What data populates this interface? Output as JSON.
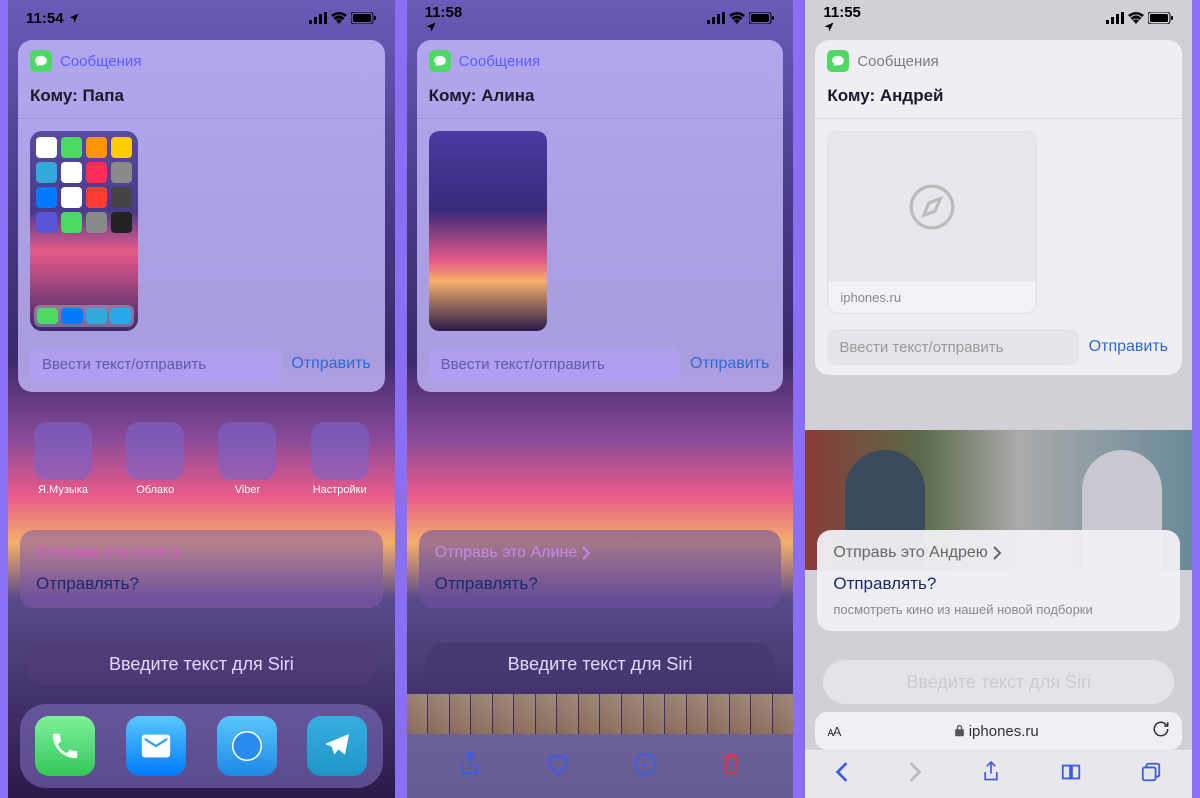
{
  "screens": [
    {
      "status_time": "11:54",
      "app_title": "Сообщения",
      "to_prefix": "Кому:",
      "to_name": "Папа",
      "input_placeholder": "Ввести текст/отправить",
      "send_label": "Отправить",
      "siri_suggestion": "Отправь это папе",
      "siri_confirm": "Отправлять?",
      "siri_input": "Введите текст для Siri",
      "home_apps": [
        "Я.Музыка",
        "Облако",
        "Viber",
        "Настройки"
      ]
    },
    {
      "status_time": "11:58",
      "app_title": "Сообщения",
      "to_prefix": "Кому:",
      "to_name": "Алина",
      "input_placeholder": "Ввести текст/отправить",
      "send_label": "Отправить",
      "siri_suggestion": "Отправь это Алине",
      "siri_confirm": "Отправлять?",
      "siri_input": "Введите текст для Siri"
    },
    {
      "status_time": "11:55",
      "app_title": "Сообщения",
      "to_prefix": "Кому:",
      "to_name": "Андрей",
      "link_domain": "iphones.ru",
      "input_placeholder": "Ввести текст/отправить",
      "send_label": "Отправить",
      "siri_suggestion": "Отправь это Андрею",
      "siri_confirm": "Отправлять?",
      "siri_sub": "посмотреть кино из нашей новой подборки",
      "siri_input": "Введите текст для Siri",
      "url_display": "iphones.ru",
      "aa_label": "ᴀA"
    }
  ]
}
